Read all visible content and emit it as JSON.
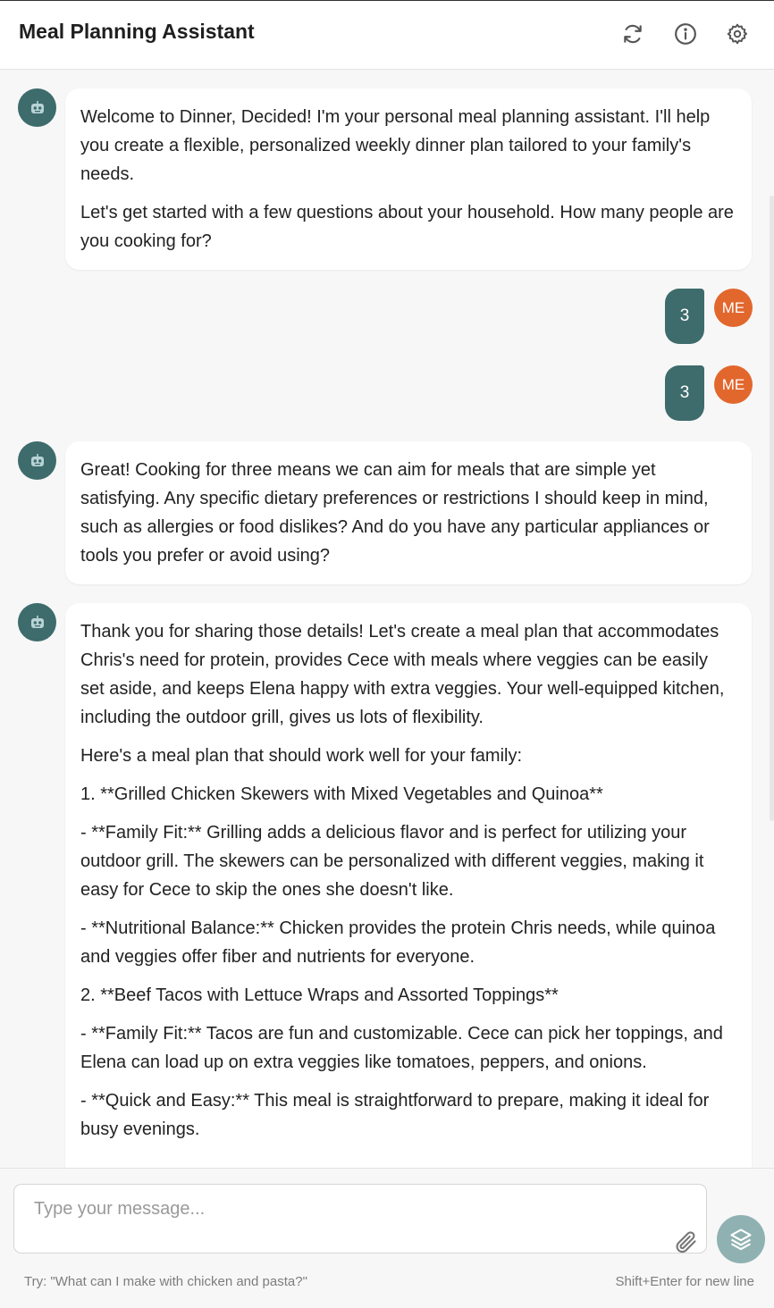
{
  "header": {
    "title": "Meal Planning Assistant",
    "icons": [
      "refresh-icon",
      "info-icon",
      "settings-icon"
    ]
  },
  "user": {
    "initials": "ME"
  },
  "messages": [
    {
      "role": "assistant",
      "paragraphs": [
        "Welcome to Dinner, Decided! I'm your personal meal planning assistant. I'll help you create a flexible, personalized weekly dinner plan tailored to your family's needs.",
        "Let's get started with a few questions about your household. How many people are you cooking for?"
      ]
    },
    {
      "role": "user",
      "text": "3"
    },
    {
      "role": "user",
      "text": "3"
    },
    {
      "role": "assistant",
      "paragraphs": [
        "Great! Cooking for three means we can aim for meals that are simple yet satisfying. Any specific dietary preferences or restrictions I should keep in mind, such as allergies or food dislikes? And do you have any particular appliances or tools you prefer or avoid using?"
      ]
    },
    {
      "role": "assistant",
      "paragraphs": [
        "Thank you for sharing those details! Let's create a meal plan that accommodates Chris's need for protein, provides Cece with meals where veggies can be easily set aside, and keeps Elena happy with extra veggies. Your well-equipped kitchen, including the outdoor grill, gives us lots of flexibility.",
        "Here's a meal plan that should work well for your family:",
        "1. **Grilled Chicken Skewers with Mixed Vegetables and Quinoa**",
        "- **Family Fit:** Grilling adds a delicious flavor and is perfect for utilizing your outdoor grill. The skewers can be personalized with different veggies, making it easy for Cece to skip the ones she doesn't like.",
        "- **Nutritional Balance:** Chicken provides the protein Chris needs, while quinoa and veggies offer fiber and nutrients for everyone.",
        "2. **Beef Tacos with Lettuce Wraps and Assorted Toppings**",
        "- **Family Fit:** Tacos are fun and customizable. Cece can pick her toppings, and Elena can load up on extra veggies like tomatoes, peppers, and onions.",
        "- **Quick and Easy:** This meal is straightforward to prepare, making it ideal for busy evenings."
      ]
    }
  ],
  "composer": {
    "placeholder": "Type your message...",
    "hint": "Try: \"What can I make with chicken and pasta?\"",
    "shortcut_hint": "Shift+Enter for new line"
  },
  "colors": {
    "accent": "#3e6b6b",
    "user_avatar": "#e2672d",
    "send_button": "#8fb1b1",
    "background": "#f7f7f7"
  }
}
